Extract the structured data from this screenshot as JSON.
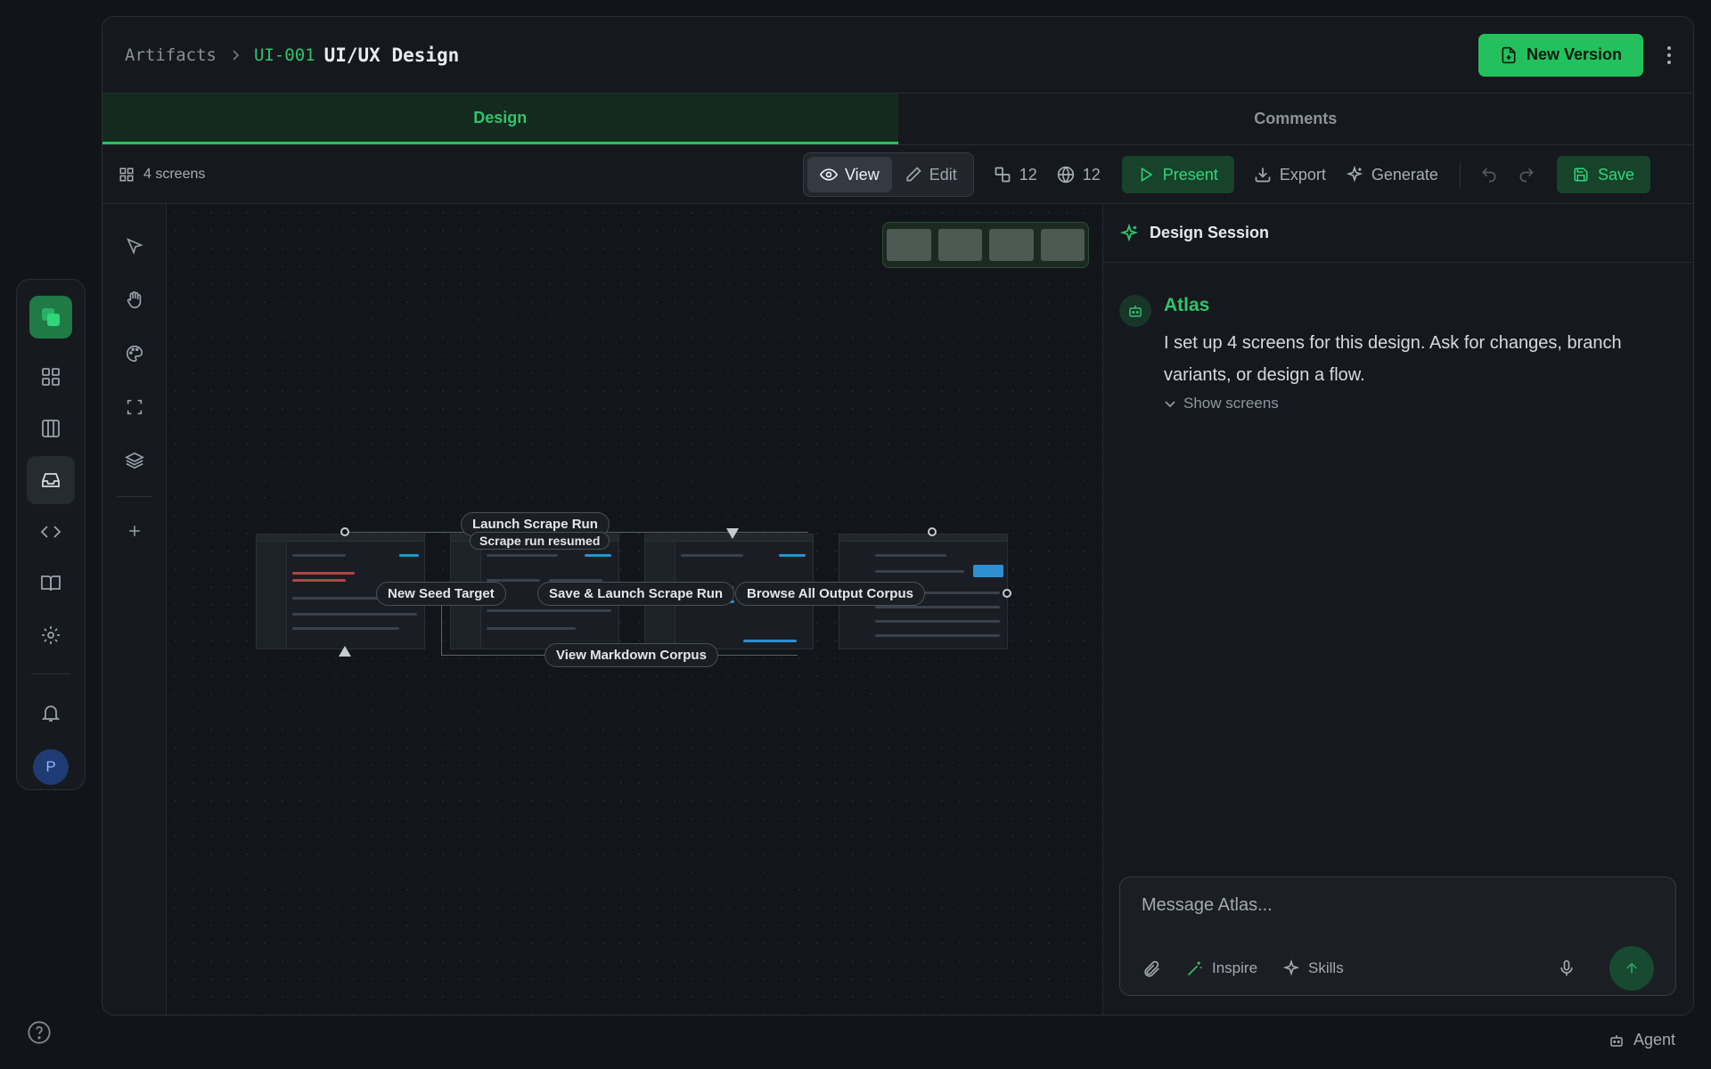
{
  "header": {
    "breadcrumb_root": "Artifacts",
    "doc_id": "UI-001",
    "doc_title": "UI/UX Design",
    "new_version_label": "New Version"
  },
  "tabs": [
    {
      "label": "Design",
      "active": true
    },
    {
      "label": "Comments",
      "active": false
    }
  ],
  "toolbar": {
    "screens_count": "4 screens",
    "view_label": "View",
    "edit_label": "Edit",
    "components_count": "12",
    "globe_count": "12",
    "present_label": "Present",
    "export_label": "Export",
    "generate_label": "Generate",
    "save_label": "Save"
  },
  "canvas": {
    "flow_labels": {
      "launch_scrape_run": "Launch Scrape Run",
      "scrape_run_resumed": "Scrape run resumed",
      "new_seed_target": "New Seed Target",
      "save_launch": "Save & Launch Scrape Run",
      "browse_all": "Browse All Output Corpus",
      "view_markdown": "View Markdown Corpus"
    }
  },
  "session": {
    "title": "Design Session",
    "bot_name": "Atlas",
    "message": "I set up 4 screens for this design. Ask for changes, branch variants, or design a flow.",
    "show_screens": "Show screens",
    "composer_placeholder": "Message Atlas...",
    "inspire_label": "Inspire",
    "skills_label": "Skills"
  },
  "rail": {
    "avatar_initial": "P"
  },
  "footer": {
    "agent_label": "Agent"
  },
  "colors": {
    "accent": "#22c15e",
    "background": "#111418",
    "panel": "#15181c"
  }
}
